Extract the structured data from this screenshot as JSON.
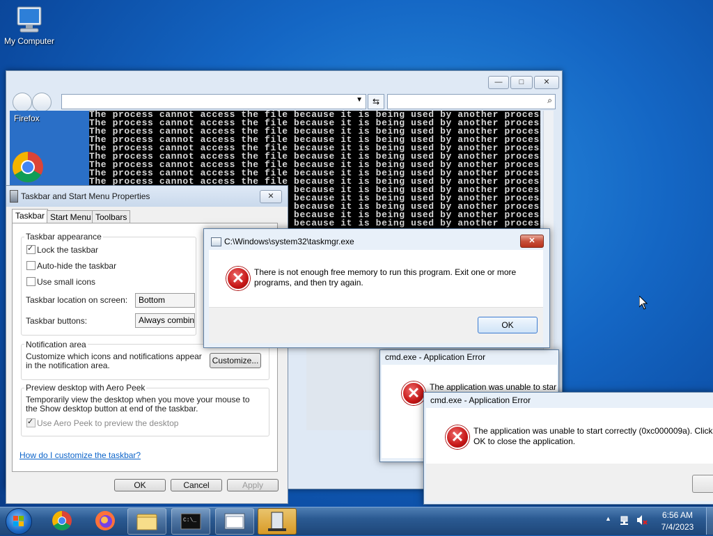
{
  "desktop": {
    "icon_label": "My Computer"
  },
  "explorer": {
    "min_label": "—",
    "max_label": "□",
    "close_label": "✕",
    "sidebar_label": "Firefox"
  },
  "console": {
    "lines": [
      "The process cannot access the file because it is being used by another process.",
      "The process cannot access the file because it is being used by another process.",
      "The process cannot access the file because it is being used by another process.",
      "The process cannot access the file because it is being used by another process.",
      "The process cannot access the file because it is being used by another process.",
      "The process cannot access the file because it is being used by another process.",
      "The process cannot access the file because it is being used by another process.",
      "The process cannot access the file because it is being used by another process.",
      "The process cannot access the file because it is being used by another process.",
      "The process cannot access the file because it is being used by another process.",
      "The process cannot access the file because it is being used by another process.",
      "The process cannot access the file because it is being used by another process.",
      "The process cannot access the file because it is being used by another process.",
      "The process cannot access the file because it is being used by another process."
    ]
  },
  "props": {
    "title": "Taskbar and Start Menu Properties",
    "tabs": [
      "Taskbar",
      "Start Menu",
      "Toolbars"
    ],
    "appearance_heading": "Taskbar appearance",
    "lock_label": "Lock the taskbar",
    "autohide_label": "Auto-hide the taskbar",
    "small_icons_label": "Use small icons",
    "location_label": "Taskbar location on screen:",
    "location_value": "Bottom",
    "buttons_label": "Taskbar buttons:",
    "buttons_value": "Always combine",
    "notif_heading": "Notification area",
    "notif_text": "Customize which icons and notifications appear in the notification area.",
    "customize_label": "Customize...",
    "peek_heading": "Preview desktop with Aero Peek",
    "peek_text": "Temporarily view the desktop when you move your mouse to the Show desktop button at end of the taskbar.",
    "peek_check_label": "Use Aero Peek to preview the desktop",
    "help_link": "How do I customize the taskbar?",
    "ok_label": "OK",
    "cancel_label": "Cancel",
    "apply_label": "Apply"
  },
  "taskmgr_dialog": {
    "title": "C:\\Windows\\system32\\taskmgr.exe",
    "message": "There is not enough free memory to run this program. Exit one or more programs, and then try again.",
    "ok_label": "OK"
  },
  "cmd_error_1": {
    "title": "cmd.exe - Application Error",
    "message": "The application was unable to start correctly"
  },
  "cmd_error_2": {
    "title": "cmd.exe - Application Error",
    "message": "The application was unable to start correctly (0xc000009a). Click OK to close the application."
  },
  "tray": {
    "time": "6:56 AM",
    "date": "7/4/2023"
  },
  "colors": {
    "link": "#0b63c9",
    "taskbar_active": "#e0b04a"
  }
}
